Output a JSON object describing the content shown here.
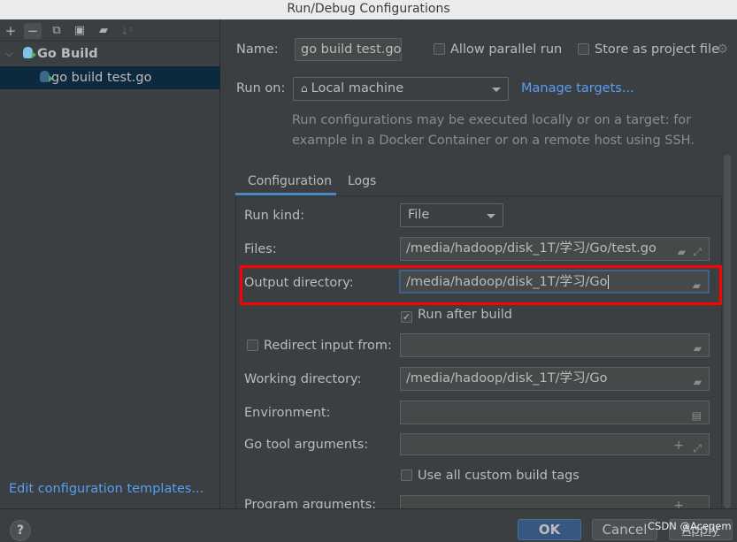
{
  "window": {
    "title": "Run/Debug Configurations"
  },
  "toolbar": {
    "icons": [
      "plus-icon",
      "minus-icon",
      "copy-icon",
      "save-icon",
      "folder-add-icon",
      "sort-az-icon"
    ]
  },
  "tree": {
    "group": "Go Build",
    "items": [
      {
        "label": "go build test.go",
        "selected": true
      }
    ]
  },
  "edit_templates": "Edit configuration templates...",
  "form": {
    "name_label": "Name:",
    "name_value": "go build test.go",
    "allow_parallel": {
      "label": "Allow parallel run",
      "checked": false
    },
    "store_project": {
      "label": "Store as project file",
      "checked": false
    },
    "run_on_label": "Run on:",
    "run_on_value": "Local machine",
    "manage_targets": "Manage targets...",
    "help_line1": "Run configurations may be executed locally or on a target: for",
    "help_line2": "example in a Docker Container or on a remote host using SSH.",
    "tabs": [
      {
        "label": "Configuration",
        "active": true
      },
      {
        "label": "Logs",
        "active": false
      }
    ],
    "run_kind_label": "Run kind:",
    "run_kind_value": "File",
    "files_label": "Files:",
    "files_value": "/media/hadoop/disk_1T/学习/Go/test.go",
    "output_label": "Output directory:",
    "output_value": "/media/hadoop/disk_1T/学习/Go",
    "run_after_build": {
      "label": "Run after build",
      "checked": true
    },
    "redirect": {
      "label": "Redirect input from:",
      "checked": false,
      "value": ""
    },
    "working_label": "Working directory:",
    "working_value": "/media/hadoop/disk_1T/学习/Go",
    "env_label": "Environment:",
    "env_value": "",
    "gotool_label": "Go tool arguments:",
    "gotool_value": "",
    "custom_tags": {
      "label": "Use all custom build tags",
      "checked": false
    },
    "program_label": "Program arguments:"
  },
  "buttons": {
    "ok": "OK",
    "cancel": "Cancel",
    "apply": "Apply",
    "help": "?"
  },
  "watermark": "CSDN @Acegem",
  "colors": {
    "accent": "#589df6",
    "highlight": "#ff0000",
    "ok": "#365880",
    "selection": "#0d293e"
  }
}
